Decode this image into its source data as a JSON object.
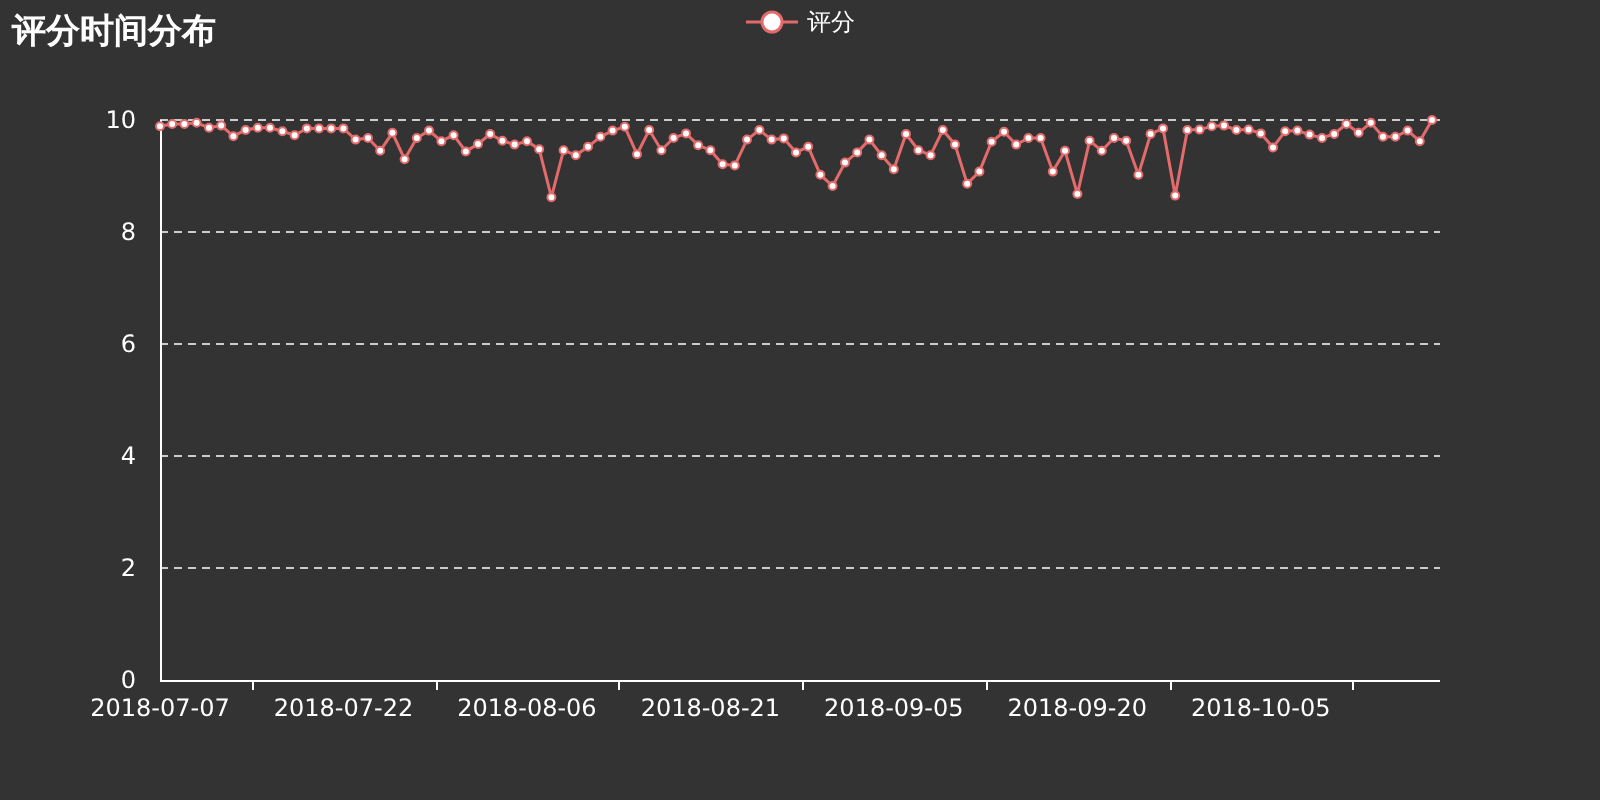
{
  "title": "评分时间分布",
  "chart_data": {
    "type": "line",
    "grid": true,
    "categories": [
      "2018-07-07",
      null,
      null,
      null,
      null,
      null,
      null,
      null,
      null,
      null,
      null,
      null,
      null,
      null,
      null,
      "2018-07-22",
      null,
      null,
      null,
      null,
      null,
      null,
      null,
      null,
      null,
      null,
      null,
      null,
      null,
      null,
      "2018-08-06",
      null,
      null,
      null,
      null,
      null,
      null,
      null,
      null,
      null,
      null,
      null,
      null,
      null,
      null,
      "2018-08-21",
      null,
      null,
      null,
      null,
      null,
      null,
      null,
      null,
      null,
      null,
      null,
      null,
      null,
      null,
      "2018-09-05",
      null,
      null,
      null,
      null,
      null,
      null,
      null,
      null,
      null,
      null,
      null,
      null,
      null,
      null,
      "2018-09-20",
      null,
      null,
      null,
      null,
      null,
      null,
      null,
      null,
      null,
      null,
      null,
      null,
      null,
      null,
      "2018-10-05",
      null,
      null,
      null,
      null,
      null,
      null,
      null,
      null,
      null,
      null,
      null,
      null,
      null,
      null
    ],
    "series": [
      {
        "name": "评分",
        "color": "#e46b6b",
        "marker": "circle",
        "values": [
          9.89,
          9.93,
          9.93,
          9.95,
          9.86,
          9.9,
          9.71,
          9.82,
          9.86,
          9.86,
          9.8,
          9.73,
          9.85,
          9.85,
          9.85,
          9.85,
          9.65,
          9.68,
          9.45,
          9.77,
          9.3,
          9.68,
          9.81,
          9.62,
          9.73,
          9.44,
          9.57,
          9.75,
          9.63,
          9.56,
          9.62,
          9.48,
          8.62,
          9.46,
          9.37,
          9.52,
          9.7,
          9.81,
          9.88,
          9.39,
          9.82,
          9.46,
          9.68,
          9.76,
          9.55,
          9.46,
          9.21,
          9.19,
          9.65,
          9.82,
          9.65,
          9.67,
          9.42,
          9.52,
          9.02,
          8.82,
          9.24,
          9.42,
          9.65,
          9.37,
          9.12,
          9.75,
          9.46,
          9.37,
          9.82,
          9.56,
          8.86,
          9.08,
          9.61,
          9.79,
          9.56,
          9.68,
          9.68,
          9.08,
          9.45,
          8.68,
          9.63,
          9.45,
          9.68,
          9.63,
          9.02,
          9.75,
          9.85,
          8.65,
          9.82,
          9.83,
          9.89,
          9.9,
          9.82,
          9.83,
          9.76,
          9.51,
          9.8,
          9.81,
          9.74,
          9.68,
          9.75,
          9.93,
          9.77,
          9.95,
          9.7,
          9.7,
          9.81,
          9.62,
          10.0
        ]
      }
    ],
    "ylim": [
      0,
      10
    ],
    "yticks": [
      0,
      2,
      4,
      6,
      8,
      10
    ]
  }
}
